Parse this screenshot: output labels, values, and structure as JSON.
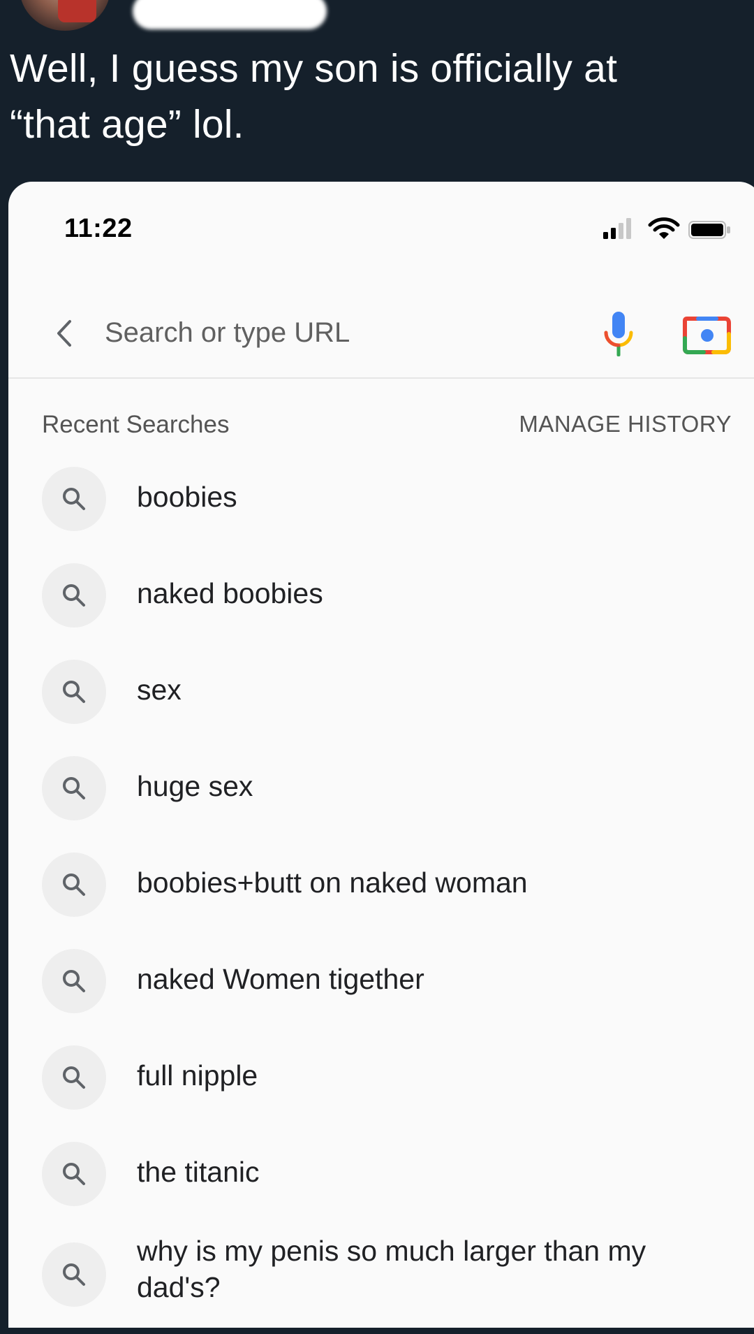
{
  "tweet": {
    "text_line1": "Well, I guess my son is officially at",
    "text_line2": "“that age” lol."
  },
  "status_bar": {
    "time": "11:22"
  },
  "address_bar": {
    "placeholder": "Search or type URL"
  },
  "recent": {
    "title": "Recent Searches",
    "manage_label": "MANAGE HISTORY",
    "items": [
      {
        "label": "boobies"
      },
      {
        "label": "naked boobies"
      },
      {
        "label": "sex"
      },
      {
        "label": "huge sex"
      },
      {
        "label": "boobies+butt on naked woman"
      },
      {
        "label": "naked Women tigether"
      },
      {
        "label": "full nipple"
      },
      {
        "label": "the titanic"
      },
      {
        "label": "why is my penis so much larger than my dad's?"
      }
    ]
  },
  "colors": {
    "tweet_background": "#15202b",
    "screenshot_background": "#fafafa",
    "mic_blue": "#4285f4",
    "mic_yellow": "#fbbc04",
    "lens_red": "#ea4335"
  },
  "icons": [
    "back-icon",
    "mic-icon",
    "lens-icon",
    "search-icon",
    "signal-icon",
    "wifi-icon",
    "battery-icon"
  ]
}
